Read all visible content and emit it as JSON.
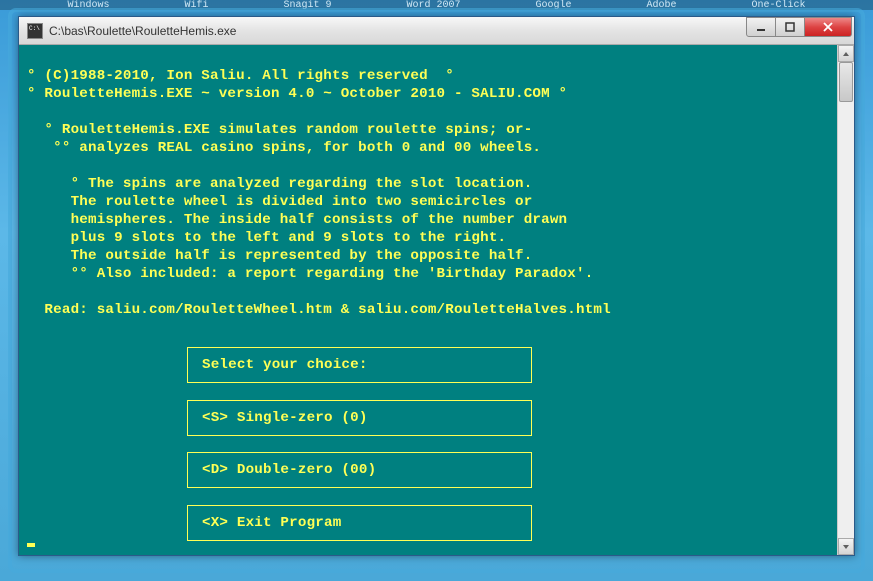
{
  "taskbar": {
    "items": [
      "Windows",
      "Wifi",
      "Snagit 9",
      "Word 2007",
      "Google",
      "Adobe",
      "One-Click"
    ]
  },
  "window": {
    "title": "C:\\bas\\Roulette\\RouletteHemis.exe"
  },
  "console": {
    "line1": "° (C)1988-2010, Ion Saliu. All rights reserved  °",
    "line2": "° RouletteHemis.EXE ~ version 4.0 ~ October 2010 - SALIU.COM °",
    "line3": "  ° RouletteHemis.EXE simulates random roulette spins; or-",
    "line4": "   °° analyzes REAL casino spins, for both 0 and 00 wheels.",
    "line5": "     ° The spins are analyzed regarding the slot location.",
    "line6": "     The roulette wheel is divided into two semicircles or",
    "line7": "     hemispheres. The inside half consists of the number drawn",
    "line8": "     plus 9 slots to the left and 9 slots to the right.",
    "line9": "     The outside half is represented by the opposite half.",
    "line10": "     °° Also included: a report regarding the 'Birthday Paradox'.",
    "line11": "  Read: saliu.com/RouletteWheel.htm & saliu.com/RouletteHalves.html"
  },
  "menu": {
    "header": "Select your choice:",
    "opt1": "<S> Single-zero (0)",
    "opt2": "<D> Double-zero (00)",
    "opt3": "<X> Exit Program"
  }
}
